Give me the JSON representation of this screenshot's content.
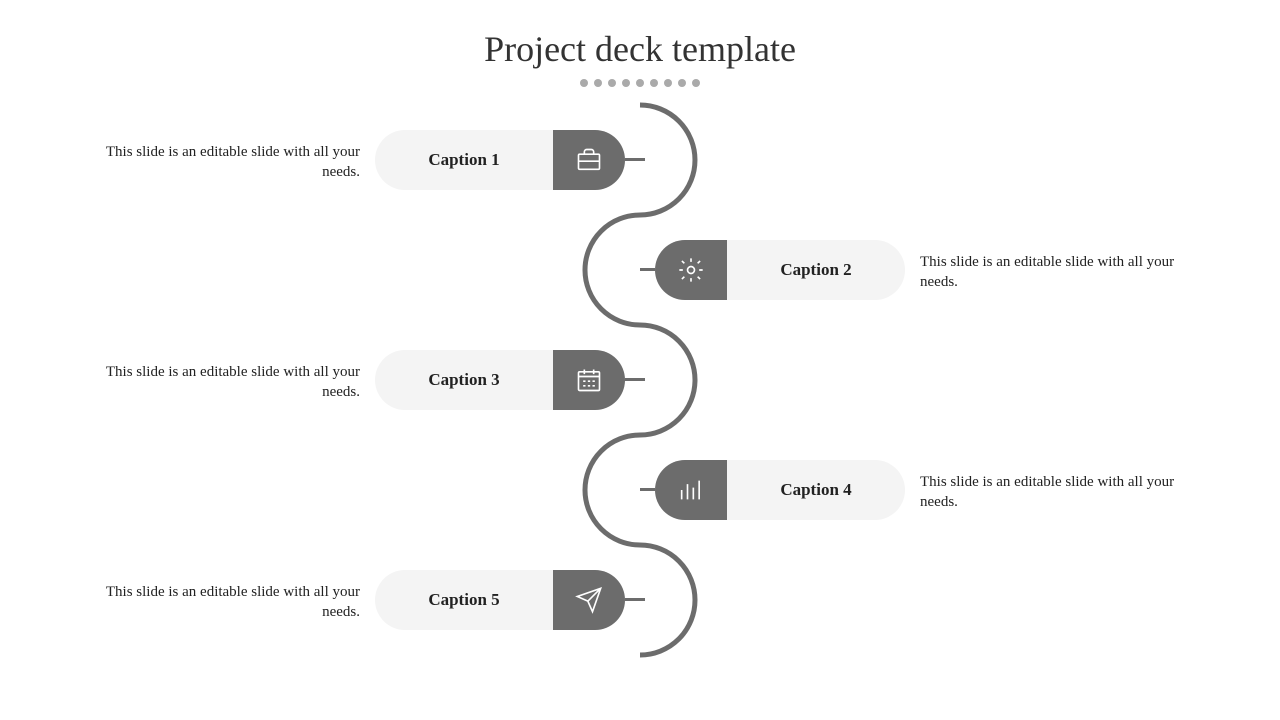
{
  "title": "Project deck template",
  "items": [
    {
      "caption": "Caption 1",
      "desc": "This slide is an editable slide with all your needs.",
      "icon": "briefcase"
    },
    {
      "caption": "Caption 2",
      "desc": "This slide is an editable slide with all your needs.",
      "icon": "gear"
    },
    {
      "caption": "Caption 3",
      "desc": "This slide is an editable slide with all your needs.",
      "icon": "calendar"
    },
    {
      "caption": "Caption 4",
      "desc": "This slide is an editable slide with all your needs.",
      "icon": "chart"
    },
    {
      "caption": "Caption 5",
      "desc": "This slide is an editable slide with all your needs.",
      "icon": "plane"
    }
  ]
}
